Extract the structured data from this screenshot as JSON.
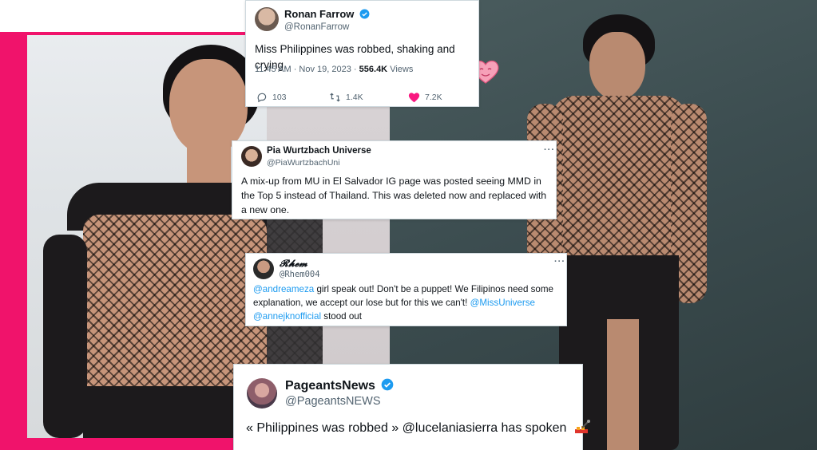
{
  "colors": {
    "pink": "#f0136b",
    "teal": "#3c4d50",
    "verified": "#1d9bf0",
    "like": "#f91880"
  },
  "tweets": [
    {
      "name": "Ronan Farrow",
      "handle": "@RonanFarrow",
      "text": "Miss Philippines was robbed, shaking and crying.",
      "time": "11:45 AM · Nov 19, 2023 · ",
      "views_count": "556.4K",
      "views_label": " Views",
      "replies": "103",
      "retweets": "1.4K",
      "likes": "7.2K"
    },
    {
      "name": "Pia Wurtzbach Universe",
      "handle": "@PiaWurtzbachUni",
      "text": "A mix-up from MU in El Salvador IG page was posted seeing MMD in the Top 5 instead of Thailand. This was deleted now and replaced with a new one.",
      "more": "···"
    },
    {
      "name": "𝓡𝓱𝓮𝓶",
      "handle": "@Rhem004",
      "mention1": "@andreameza",
      "text1": " girl speak out! Don't be a puppet! We Filipinos need some explanation, we accept our lose but for this we can't! ",
      "mention2": "@MissUniverse",
      "mention3": "@annejknofficial",
      "text2": "  stood out",
      "more": "···"
    },
    {
      "name": "PageantsNews",
      "handle": "@PageantsNEWS",
      "text": "« Philippines was robbed » @lucelaniasierra has spoken"
    }
  ]
}
